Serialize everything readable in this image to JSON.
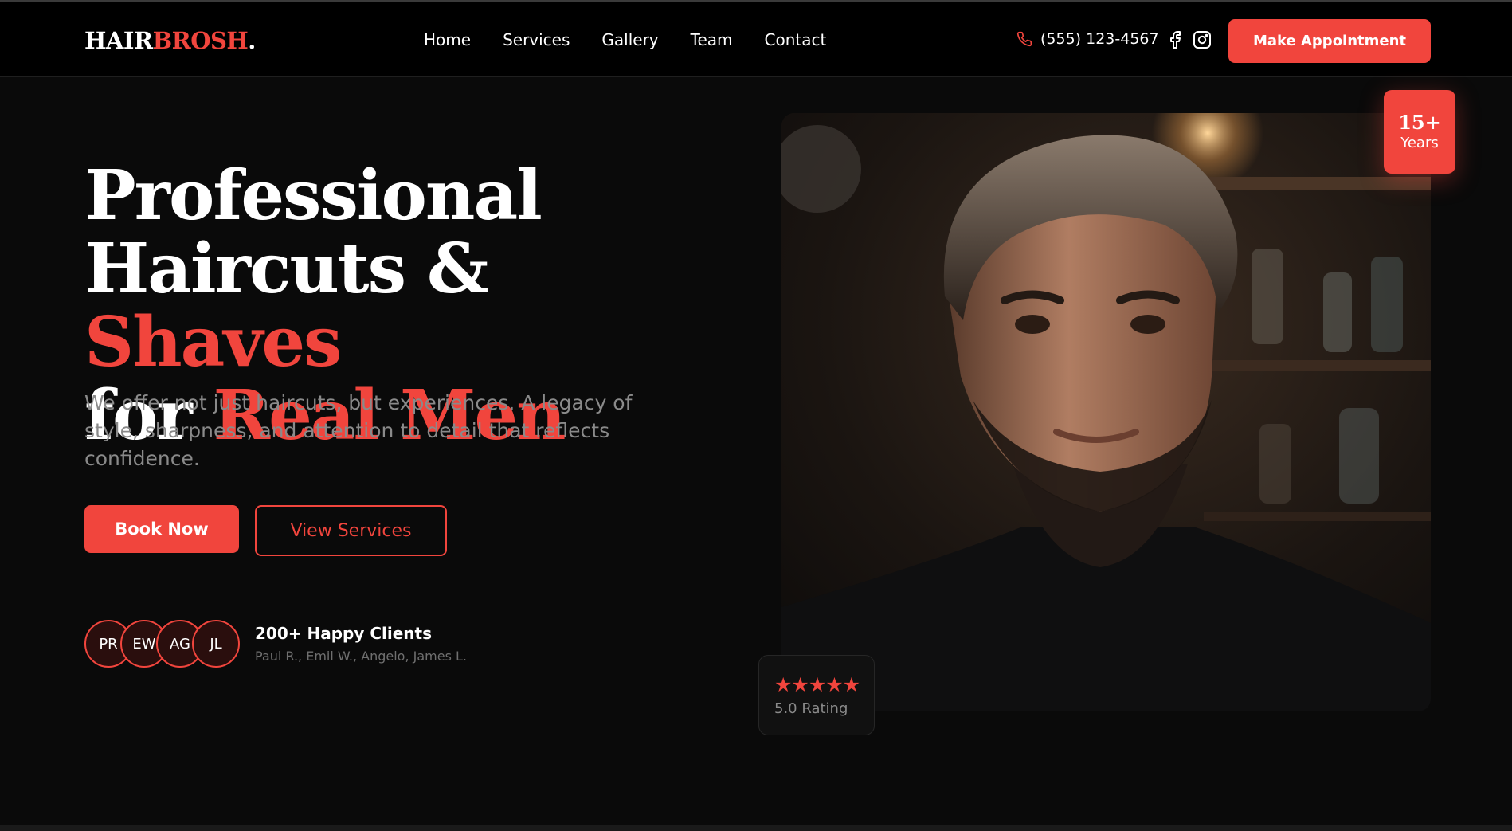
{
  "brand": {
    "part1": "HAIR",
    "part2": "BROSH",
    "part3": "."
  },
  "nav": [
    "Home",
    "Services",
    "Gallery",
    "Team",
    "Contact"
  ],
  "header": {
    "phone": "(555) 123-4567",
    "cta_label": "Make Appointment",
    "social_icons": [
      "facebook-icon",
      "instagram-icon"
    ]
  },
  "hero": {
    "title_line1": "Professional",
    "title_line2_white": "Haircuts & ",
    "title_line2_red": "Shaves",
    "title_line3_white": "for ",
    "title_line3_red": "Real Men",
    "description": "We offer not just haircuts, but experiences. A legacy of style, sharpness, and attention to detail that reflects confidence.",
    "primary_button": "Book Now",
    "secondary_button": "View Services"
  },
  "clients": {
    "avatars": [
      "PR",
      "EW",
      "AG",
      "JL"
    ],
    "title": "200+ Happy Clients",
    "names": "Paul R., Emil W., Angelo, James L."
  },
  "badge": {
    "number": "15+",
    "label": "Years"
  },
  "rating": {
    "stars": "★★★★★",
    "label": "5.0 Rating",
    "value": 5
  },
  "colors": {
    "accent": "#f1453d",
    "background": "#0a0a0a",
    "header": "#000000",
    "muted": "#8a8a8a"
  }
}
